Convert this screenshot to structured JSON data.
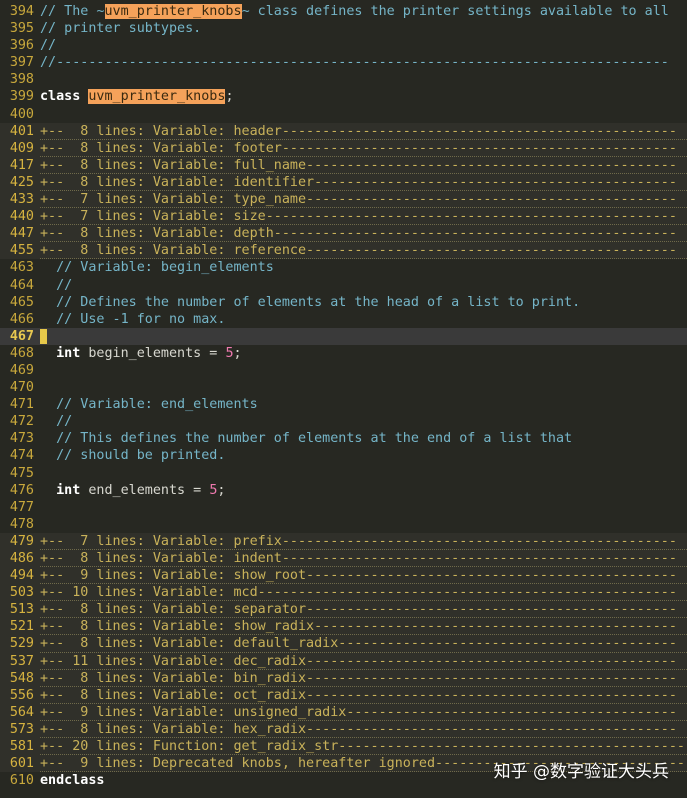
{
  "editor": {
    "lines": [
      {
        "num": "394",
        "kind": "code",
        "segments": [
          [
            "comment",
            "// The ~"
          ],
          [
            "hl",
            "uvm_printer_knobs"
          ],
          [
            "comment",
            "~ class defines the printer settings available to all"
          ]
        ]
      },
      {
        "num": "395",
        "kind": "code",
        "segments": [
          [
            "comment",
            "// printer subtypes."
          ]
        ]
      },
      {
        "num": "396",
        "kind": "code",
        "segments": [
          [
            "comment",
            "//"
          ]
        ]
      },
      {
        "num": "397",
        "kind": "code",
        "segments": [
          [
            "comment",
            "//----------------------------------------------------------------------------"
          ]
        ]
      },
      {
        "num": "398",
        "kind": "code",
        "segments": []
      },
      {
        "num": "399",
        "kind": "code",
        "segments": [
          [
            "kw",
            "class"
          ],
          [
            "text",
            " "
          ],
          [
            "hl",
            "uvm_printer_knobs"
          ],
          [
            "text",
            ";"
          ]
        ]
      },
      {
        "num": "400",
        "kind": "code",
        "segments": []
      },
      {
        "num": "401",
        "kind": "fold",
        "segments": [
          [
            "fold",
            "+--  8 lines: Variable: header-------------------------------------------------"
          ]
        ]
      },
      {
        "num": "409",
        "kind": "fold",
        "segments": [
          [
            "fold",
            "+--  8 lines: Variable: footer-------------------------------------------------"
          ]
        ]
      },
      {
        "num": "417",
        "kind": "fold",
        "segments": [
          [
            "fold",
            "+--  8 lines: Variable: full_name----------------------------------------------"
          ]
        ]
      },
      {
        "num": "425",
        "kind": "fold",
        "segments": [
          [
            "fold",
            "+--  8 lines: Variable: identifier---------------------------------------------"
          ]
        ]
      },
      {
        "num": "433",
        "kind": "fold",
        "segments": [
          [
            "fold",
            "+--  7 lines: Variable: type_name----------------------------------------------"
          ]
        ]
      },
      {
        "num": "440",
        "kind": "fold",
        "segments": [
          [
            "fold",
            "+--  7 lines: Variable: size---------------------------------------------------"
          ]
        ]
      },
      {
        "num": "447",
        "kind": "fold",
        "segments": [
          [
            "fold",
            "+--  8 lines: Variable: depth--------------------------------------------------"
          ]
        ]
      },
      {
        "num": "455",
        "kind": "fold",
        "segments": [
          [
            "fold",
            "+--  8 lines: Variable: reference----------------------------------------------"
          ]
        ]
      },
      {
        "num": "463",
        "kind": "code",
        "segments": [
          [
            "comment",
            "  // Variable: begin_elements"
          ]
        ]
      },
      {
        "num": "464",
        "kind": "code",
        "segments": [
          [
            "comment",
            "  //"
          ]
        ]
      },
      {
        "num": "465",
        "kind": "code",
        "segments": [
          [
            "comment",
            "  // Defines the number of elements at the head of a list to print."
          ]
        ]
      },
      {
        "num": "466",
        "kind": "code",
        "segments": [
          [
            "comment",
            "  // Use -1 for no max."
          ]
        ]
      },
      {
        "num": "467",
        "kind": "current",
        "segments": []
      },
      {
        "num": "468",
        "kind": "code",
        "segments": [
          [
            "text",
            "  "
          ],
          [
            "kw",
            "int"
          ],
          [
            "text",
            " begin_elements = "
          ],
          [
            "num",
            "5"
          ],
          [
            "text",
            ";"
          ]
        ]
      },
      {
        "num": "469",
        "kind": "code",
        "segments": []
      },
      {
        "num": "470",
        "kind": "code",
        "segments": []
      },
      {
        "num": "471",
        "kind": "code",
        "segments": [
          [
            "comment",
            "  // Variable: end_elements"
          ]
        ]
      },
      {
        "num": "472",
        "kind": "code",
        "segments": [
          [
            "comment",
            "  //"
          ]
        ]
      },
      {
        "num": "473",
        "kind": "code",
        "segments": [
          [
            "comment",
            "  // This defines the number of elements at the end of a list that"
          ]
        ]
      },
      {
        "num": "474",
        "kind": "code",
        "segments": [
          [
            "comment",
            "  // should be printed."
          ]
        ]
      },
      {
        "num": "475",
        "kind": "code",
        "segments": []
      },
      {
        "num": "476",
        "kind": "code",
        "segments": [
          [
            "text",
            "  "
          ],
          [
            "kw",
            "int"
          ],
          [
            "text",
            " end_elements = "
          ],
          [
            "num",
            "5"
          ],
          [
            "text",
            ";"
          ]
        ]
      },
      {
        "num": "477",
        "kind": "code",
        "segments": []
      },
      {
        "num": "478",
        "kind": "code",
        "segments": []
      },
      {
        "num": "479",
        "kind": "fold",
        "segments": [
          [
            "fold",
            "+--  7 lines: Variable: prefix-------------------------------------------------"
          ]
        ]
      },
      {
        "num": "486",
        "kind": "fold",
        "segments": [
          [
            "fold",
            "+--  8 lines: Variable: indent-------------------------------------------------"
          ]
        ]
      },
      {
        "num": "494",
        "kind": "fold",
        "segments": [
          [
            "fold",
            "+--  9 lines: Variable: show_root----------------------------------------------"
          ]
        ]
      },
      {
        "num": "503",
        "kind": "fold",
        "segments": [
          [
            "fold",
            "+-- 10 lines: Variable: mcd----------------------------------------------------"
          ]
        ]
      },
      {
        "num": "513",
        "kind": "fold",
        "segments": [
          [
            "fold",
            "+--  8 lines: Variable: separator----------------------------------------------"
          ]
        ]
      },
      {
        "num": "521",
        "kind": "fold",
        "segments": [
          [
            "fold",
            "+--  8 lines: Variable: show_radix---------------------------------------------"
          ]
        ]
      },
      {
        "num": "529",
        "kind": "fold",
        "segments": [
          [
            "fold",
            "+--  8 lines: Variable: default_radix------------------------------------------"
          ]
        ]
      },
      {
        "num": "537",
        "kind": "fold",
        "segments": [
          [
            "fold",
            "+-- 11 lines: Variable: dec_radix----------------------------------------------"
          ]
        ]
      },
      {
        "num": "548",
        "kind": "fold",
        "segments": [
          [
            "fold",
            "+--  8 lines: Variable: bin_radix----------------------------------------------"
          ]
        ]
      },
      {
        "num": "556",
        "kind": "fold",
        "segments": [
          [
            "fold",
            "+--  8 lines: Variable: oct_radix----------------------------------------------"
          ]
        ]
      },
      {
        "num": "564",
        "kind": "fold",
        "segments": [
          [
            "fold",
            "+--  9 lines: Variable: unsigned_radix-----------------------------------------"
          ]
        ]
      },
      {
        "num": "573",
        "kind": "fold",
        "segments": [
          [
            "fold",
            "+--  8 lines: Variable: hex_radix----------------------------------------------"
          ]
        ]
      },
      {
        "num": "581",
        "kind": "fold",
        "segments": [
          [
            "fold",
            "+-- 20 lines: Function: get_radix_str--------------------------------------------"
          ]
        ]
      },
      {
        "num": "601",
        "kind": "fold",
        "segments": [
          [
            "fold",
            "+--  9 lines: Deprecated knobs, hereafter ignored-------------------------------"
          ]
        ]
      },
      {
        "num": "610",
        "kind": "code",
        "segments": [
          [
            "kw",
            "endclass"
          ]
        ]
      }
    ]
  },
  "watermark": "知乎 @数字验证大头兵"
}
